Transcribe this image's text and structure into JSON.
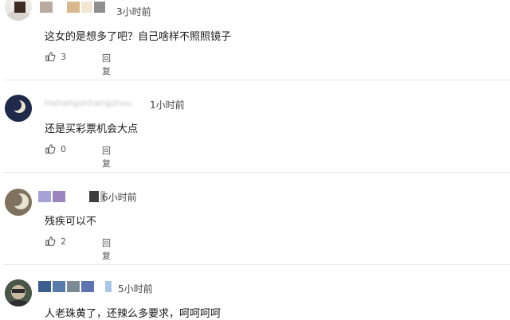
{
  "comments": [
    {
      "time": "3小时前",
      "text": "这女的是想多了吧？自己啥样不照照镜子",
      "likes": "3",
      "reply_label": "回复",
      "name_colors": [
        "#3d2b24",
        "#b9aaa2",
        "#d8b98f",
        "#f5ead8",
        "#8f8f8f"
      ],
      "avatar_colors": [
        "#e9e5e0",
        "#caa",
        "#8a7a70"
      ]
    },
    {
      "time": "1小时前",
      "text": "还是买彩票机会大点",
      "likes": "0",
      "reply_label": "回复",
      "name_colors": [],
      "avatar_colors": [
        "#1f2a4a",
        "#e9e4cf"
      ]
    },
    {
      "time": "6小时前",
      "text": "残疾可以不",
      "likes": "2",
      "reply_label": "回复",
      "name_colors": [
        "#a6a2d6",
        "#9c84bf",
        "#3e3e3e",
        "#bfbfbf"
      ],
      "avatar_colors": [
        "#8a7d66",
        "#e8e2d3"
      ]
    },
    {
      "time": "5小时前",
      "text": "人老珠黄了，还辣么多要求，呵呵呵呵",
      "likes": "",
      "reply_label": "",
      "name_colors": [
        "#3d5d8f",
        "#587aa8",
        "#7c8a98",
        "#5c73b0",
        "#a9c7e2"
      ],
      "avatar_colors": [
        "#3c4a3c",
        "#c9b8a3"
      ]
    }
  ]
}
